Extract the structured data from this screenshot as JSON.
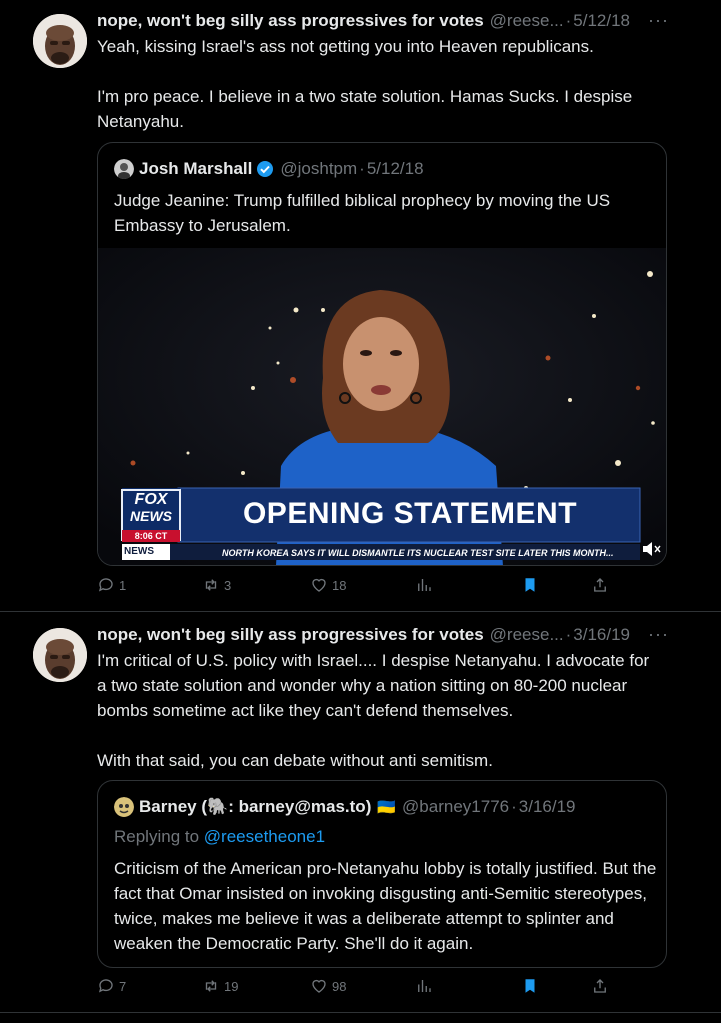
{
  "tweet1": {
    "name": "nope, won't beg silly ass progressives for votes",
    "handle": "@reese...",
    "date": "5/12/18",
    "more": "···",
    "text": "Yeah, kissing Israel's ass not getting you into Heaven republicans.\n\nI'm pro peace. I believe in a two state solution. Hamas Sucks. I despise Netanyahu.",
    "quote": {
      "name": "Josh Marshall",
      "handle": "@joshtpm",
      "date": "5/12/18",
      "text": "Judge Jeanine: Trump fulfilled biblical prophecy by moving the US Embassy to Jerusalem.",
      "media": {
        "logo_line1": "FOX",
        "logo_line2": "NEWS",
        "time": "8:06 CT",
        "headline": "OPENING STATEMENT",
        "ticker_label": "NEWS",
        "ticker": "NORTH KOREA SAYS IT WILL DISMANTLE ITS NUCLEAR TEST SITE LATER THIS MONTH..."
      }
    },
    "stats": {
      "replies": "1",
      "retweets": "3",
      "likes": "18"
    }
  },
  "tweet2": {
    "name": "nope, won't beg silly ass progressives for votes",
    "handle": "@reese...",
    "date": "3/16/19",
    "more": "···",
    "text": "I'm critical of U.S. policy with Israel.... I despise Netanyahu. I advocate for a two state solution and wonder why a nation sitting on 80-200 nuclear bombs  sometime act like they can't defend themselves.\n\nWith that said, you can debate without anti semitism.",
    "quote": {
      "name": "Barney (🐘: barney@mas.to)",
      "flag": "🇺🇦",
      "handle": "@barney1776",
      "date": "3/16/19",
      "replying_prefix": "Replying to",
      "replying_to": "@reesetheone1",
      "text": "Criticism of the American pro-Netanyahu lobby is totally justified. But the fact that Omar insisted on invoking disgusting anti-Semitic stereotypes, twice, makes me believe it was a deliberate attempt to splinter and weaken the Democratic Party. She'll do it again."
    },
    "stats": {
      "replies": "7",
      "retweets": "19",
      "likes": "98"
    }
  },
  "sep": "·",
  "colors": {
    "accent": "#1d9bf0",
    "muted": "#71767b",
    "text": "#e7e9ea",
    "border": "#2f3336"
  }
}
